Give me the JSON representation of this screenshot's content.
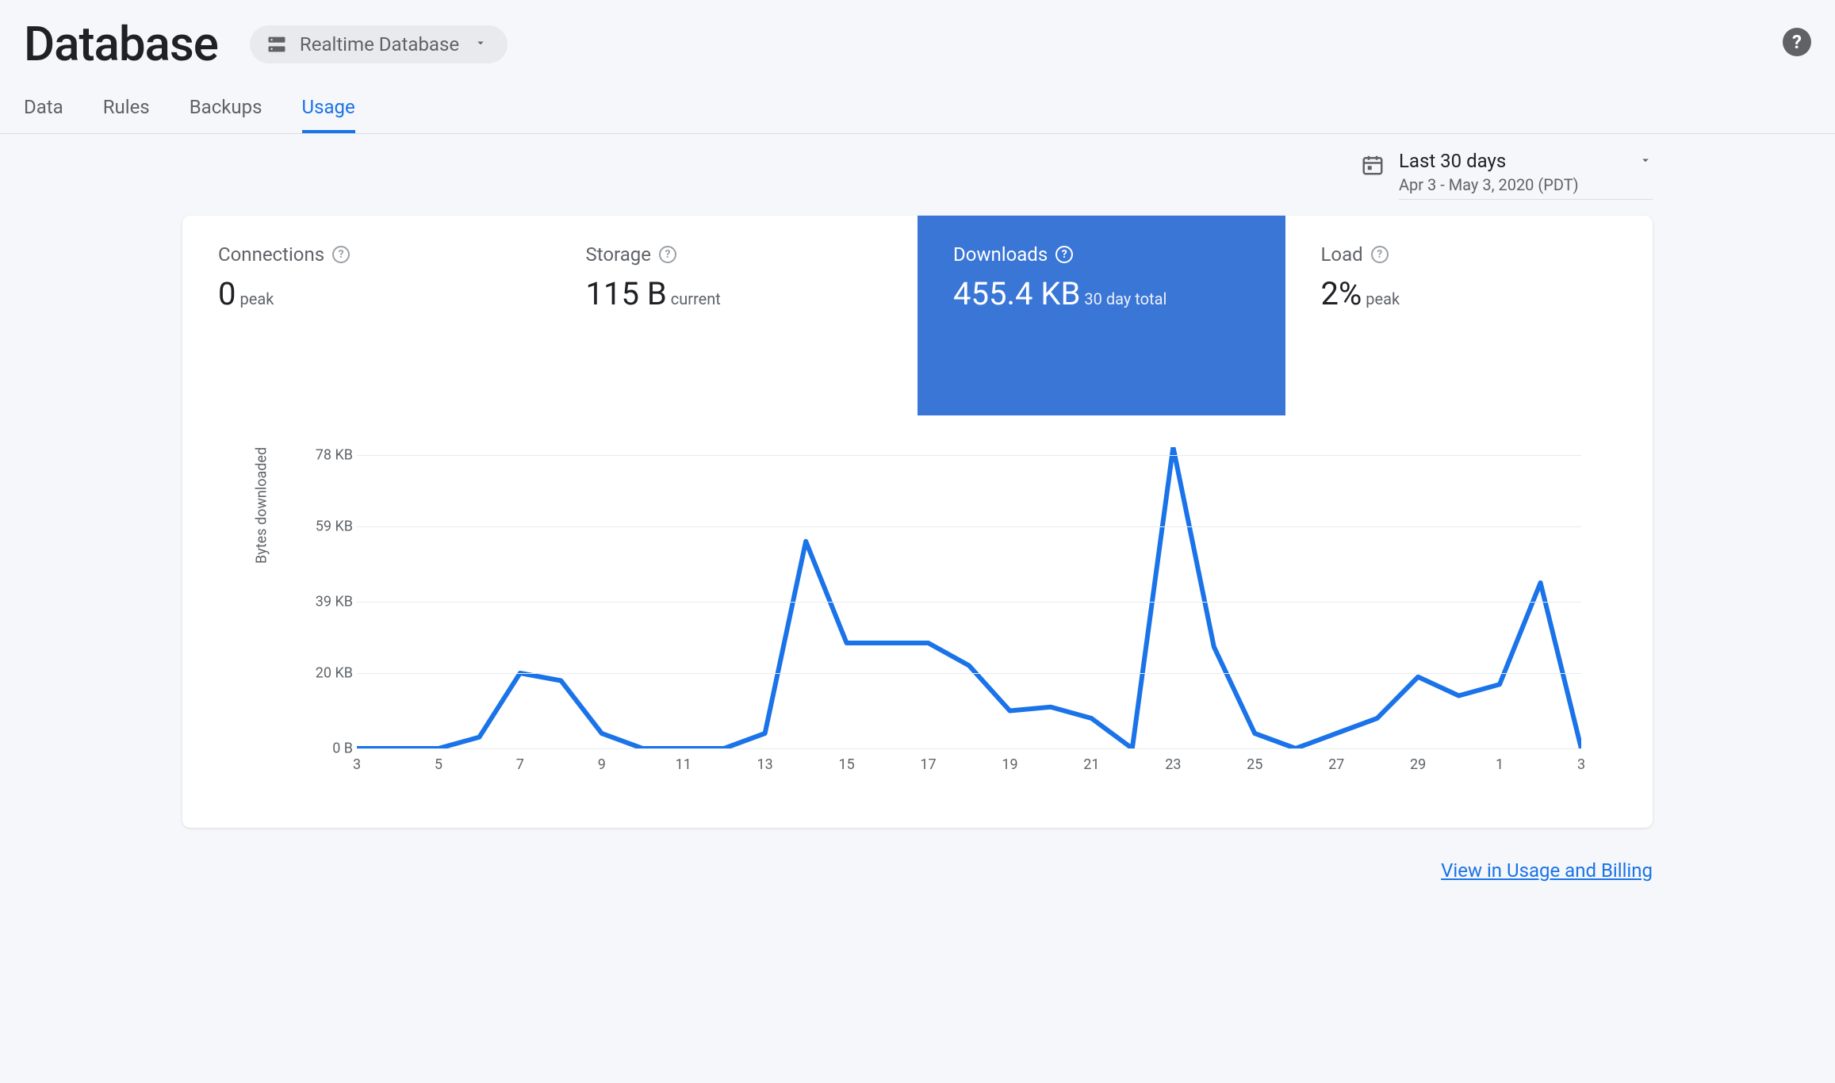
{
  "header": {
    "title": "Database",
    "db_selector_label": "Realtime Database"
  },
  "tabs": [
    {
      "label": "Data",
      "active": false
    },
    {
      "label": "Rules",
      "active": false
    },
    {
      "label": "Backups",
      "active": false
    },
    {
      "label": "Usage",
      "active": true
    }
  ],
  "date_range": {
    "label": "Last 30 days",
    "sub": "Apr 3 - May 3, 2020 (PDT)"
  },
  "metrics": [
    {
      "key": "connections",
      "title": "Connections",
      "value": "0",
      "suffix": "peak",
      "selected": false
    },
    {
      "key": "storage",
      "title": "Storage",
      "value": "115 B",
      "suffix": "current",
      "selected": false
    },
    {
      "key": "downloads",
      "title": "Downloads",
      "value": "455.4 KB",
      "suffix": "30 day total",
      "selected": true
    },
    {
      "key": "load",
      "title": "Load",
      "value": "2%",
      "suffix": "peak",
      "selected": false
    }
  ],
  "footer": {
    "link_label": "View in Usage and Billing"
  },
  "chart_data": {
    "type": "line",
    "title": "",
    "xlabel": "",
    "ylabel": "Bytes downloaded",
    "ylim": [
      0,
      80
    ],
    "y_unit": "KB",
    "y_ticks": [
      {
        "v": 0,
        "label": "0 B"
      },
      {
        "v": 20,
        "label": "20 KB"
      },
      {
        "v": 39,
        "label": "39 KB"
      },
      {
        "v": 59,
        "label": "59 KB"
      },
      {
        "v": 78,
        "label": "78 KB"
      }
    ],
    "x_ticks": [
      "3",
      "5",
      "7",
      "9",
      "11",
      "13",
      "15",
      "17",
      "19",
      "21",
      "23",
      "25",
      "27",
      "29",
      "1",
      "3"
    ],
    "x": [
      3,
      4,
      5,
      6,
      7,
      8,
      9,
      10,
      11,
      12,
      13,
      14,
      15,
      16,
      17,
      18,
      19,
      20,
      21,
      22,
      23,
      24,
      25,
      26,
      27,
      28,
      29,
      30,
      1,
      2,
      3
    ],
    "values": [
      0,
      0,
      0,
      3,
      20,
      18,
      4,
      0,
      0,
      0,
      4,
      55,
      28,
      28,
      28,
      22,
      10,
      11,
      8,
      0,
      80,
      27,
      4,
      0,
      4,
      8,
      19,
      14,
      17,
      44,
      0
    ],
    "series_color": "#1a73e8"
  }
}
